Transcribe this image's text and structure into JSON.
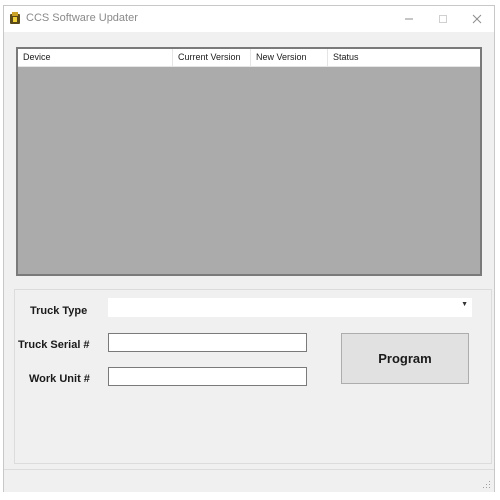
{
  "window": {
    "title": "CCS Software Updater",
    "minimize_icon": "minimize-icon",
    "maximize_icon": "maximize-icon",
    "close_icon": "close-icon",
    "app_icon": "app-icon"
  },
  "listview": {
    "columns": [
      "Device",
      "Current Version",
      "New Version",
      "Status"
    ],
    "rows": []
  },
  "form": {
    "truck_type_label": "Truck Type",
    "truck_type_value": "",
    "truck_serial_label": "Truck Serial #",
    "truck_serial_value": "",
    "work_unit_label": "Work Unit #",
    "work_unit_value": "",
    "program_button_label": "Program"
  },
  "colors": {
    "list_background": "#ababab",
    "window_background": "#f0f0f0",
    "button_background": "#e1e1e1"
  }
}
